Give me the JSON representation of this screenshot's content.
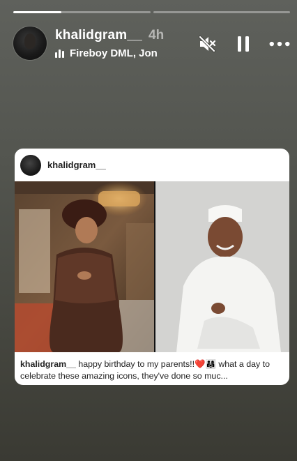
{
  "story": {
    "progress": [
      1,
      0,
      0
    ],
    "username": "khalidgram__",
    "time": "4h",
    "music": "Fireboy DML, Jon"
  },
  "controls": {
    "mute_icon": "speaker-muted-icon",
    "pause_icon": "pause-icon",
    "more_icon": "more-horizontal-icon"
  },
  "post": {
    "username": "khalidgram__",
    "caption_user": "khalidgram__",
    "caption_text": "happy birthday to my parents!!❤️👨‍👩‍👧 what a day to celebrate these amazing icons, they've done so muc..."
  },
  "colors": {
    "background": "#53554f",
    "card": "#ffffff",
    "accent_heart": "#e0245e"
  }
}
